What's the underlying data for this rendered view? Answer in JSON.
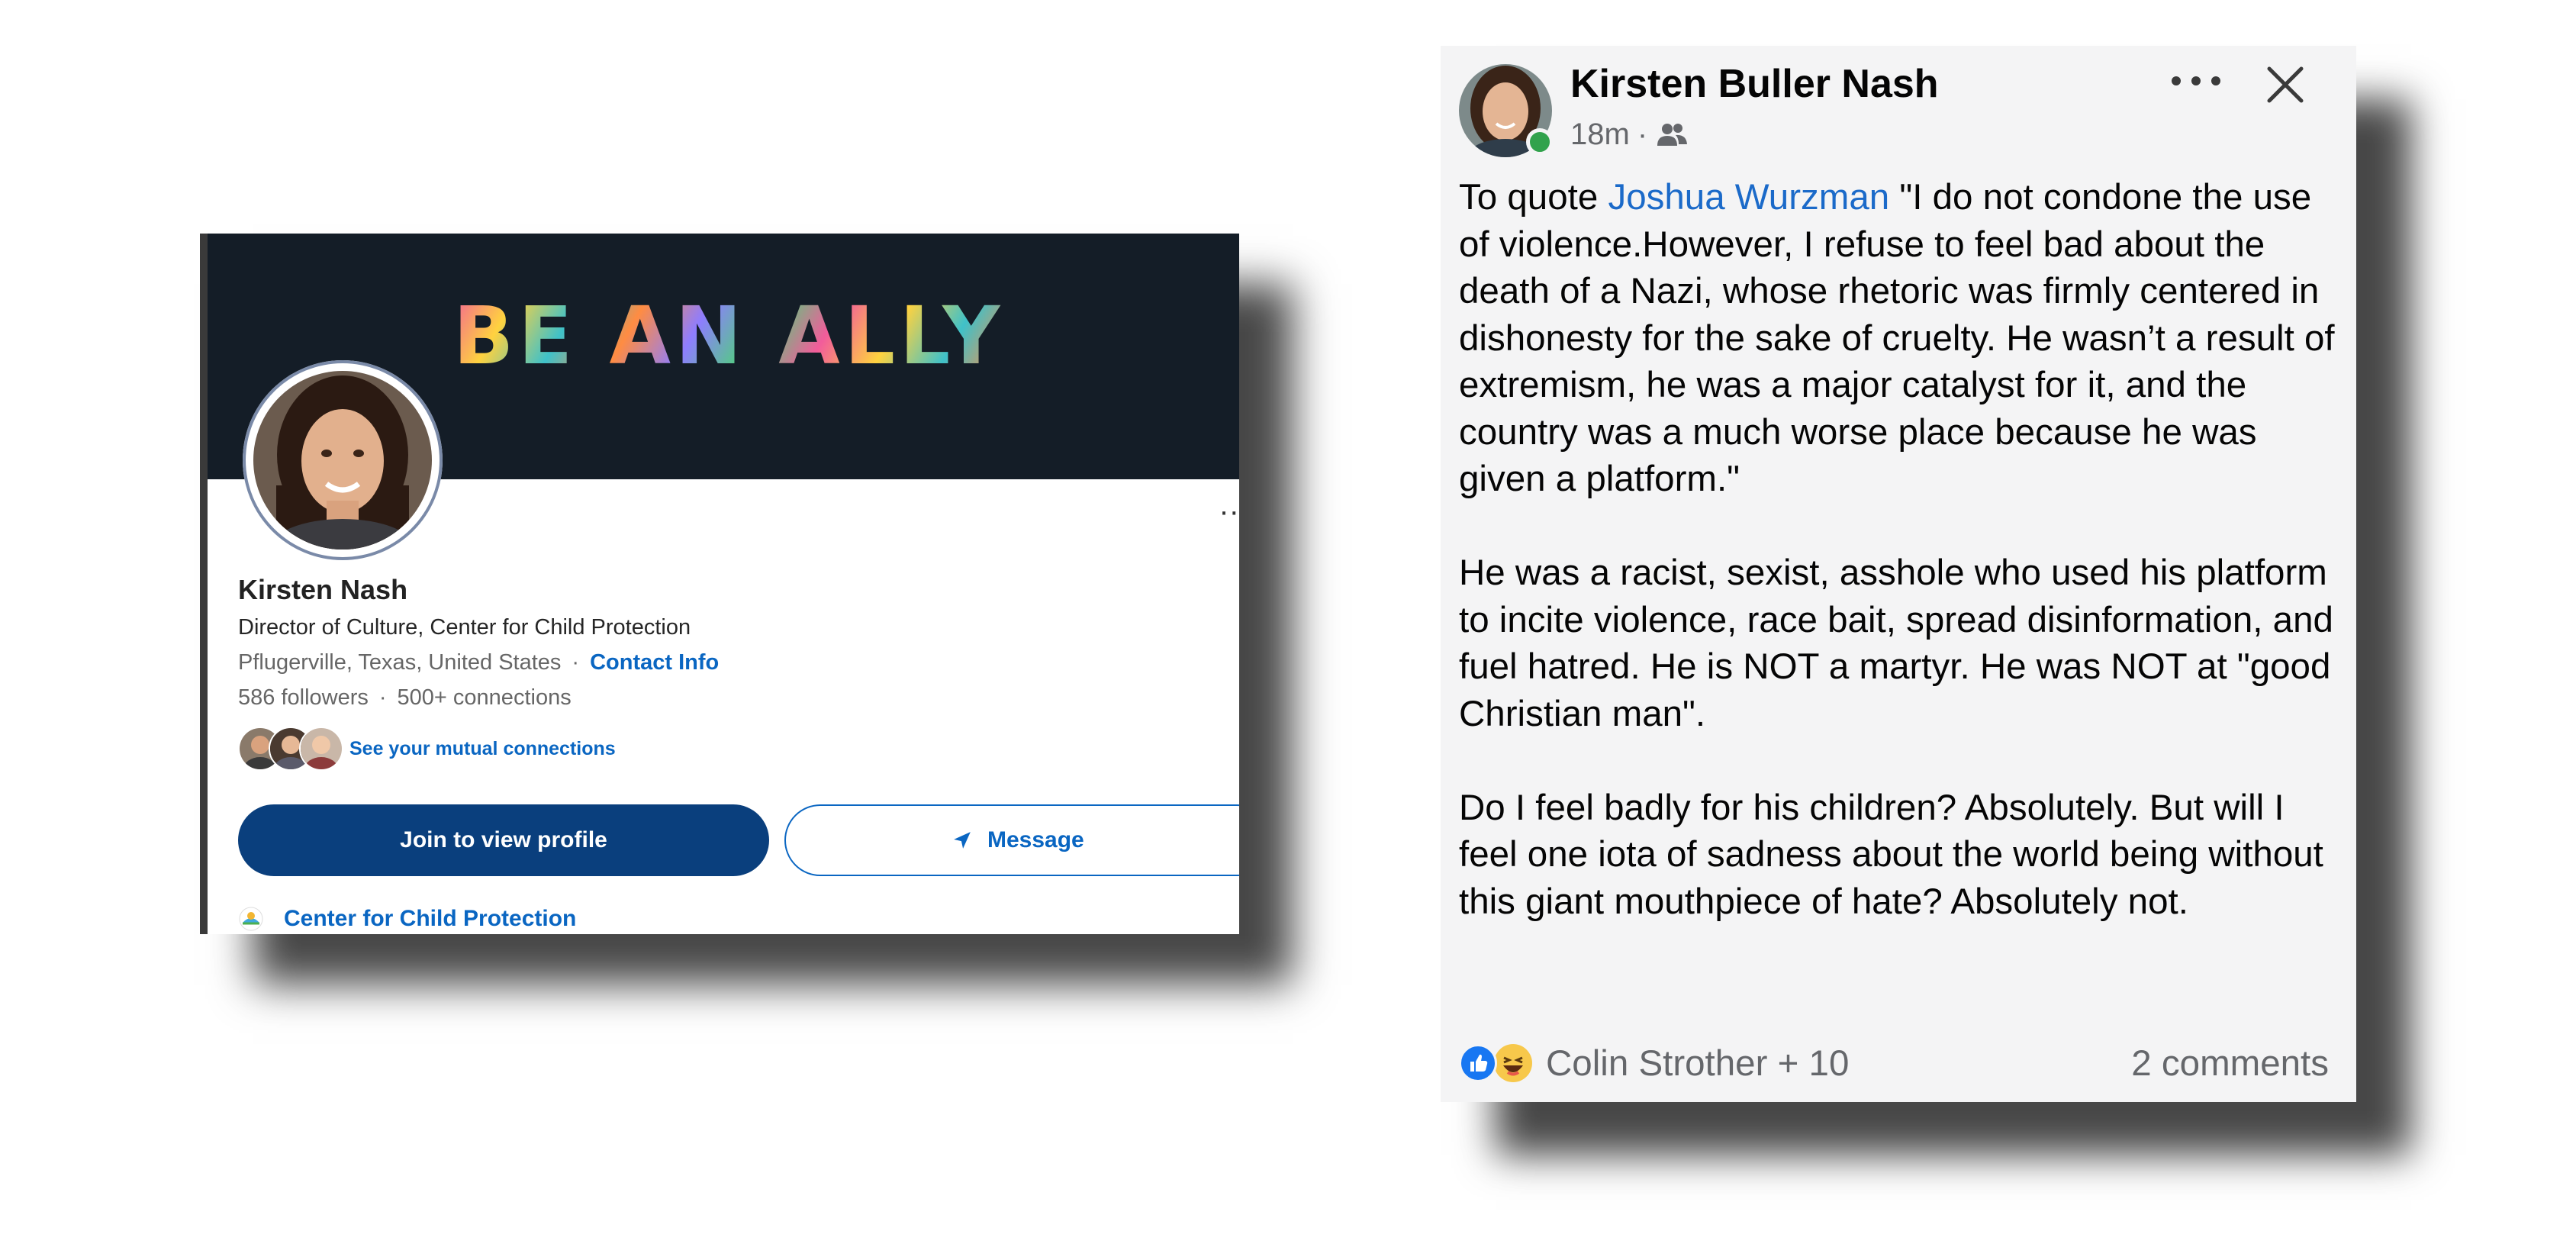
{
  "profile": {
    "banner_text": "BE AN ALLY",
    "name": "Kirsten Nash",
    "headline": "Director of Culture, Center for Child Protection",
    "location": "Pflugerville, Texas, United States",
    "separator": "·",
    "contact_info_label": "Contact Info",
    "followers": "586 followers",
    "connections": "500+ connections",
    "mutual_connections_label": "See your mutual connections",
    "join_button_label": "Join to view profile",
    "message_button_label": "Message",
    "organization": "Center for Child Protection",
    "accent_color": "#0a66c2",
    "button_color": "#0a3f7d",
    "banner_color": "#141d27",
    "icons": [
      "more-dots-icon",
      "send-icon",
      "organization-logo"
    ]
  },
  "post": {
    "author": "Kirsten Buller Nash",
    "time": "18m",
    "meta_separator": "·",
    "audience_icon": "friends-icon",
    "body": {
      "p1_prefix": "To quote ",
      "p1_mention": "Joshua Wurzman",
      "p1_text": " \"I do not condone the use of violence.However, I refuse to feel bad about the death of a Nazi, whose rhetoric was firmly centered in dishonesty for the sake of cruelty. He wasn’t a result of extremism, he was a major catalyst for it, and the country was a much worse place because he was given a platform.\"",
      "p2": "He was a racist, sexist, asshole who used his platform to incite violence, race bait, spread disinformation, and fuel hatred. He is NOT a martyr. He was NOT at \"good Christian man\".",
      "p3": "Do I feel badly for his children? Absolutely. But will I feel one iota of sadness about the world being without this giant mouthpiece of hate? Absolutely not."
    },
    "reactions_text": "Colin Strother + 10",
    "reaction_icons": [
      "like-icon",
      "haha-icon"
    ],
    "comments_count": "2 comments",
    "mention_color": "#1b6ac9",
    "online_color": "#31a24c",
    "icons": [
      "more-icon",
      "close-icon"
    ]
  }
}
